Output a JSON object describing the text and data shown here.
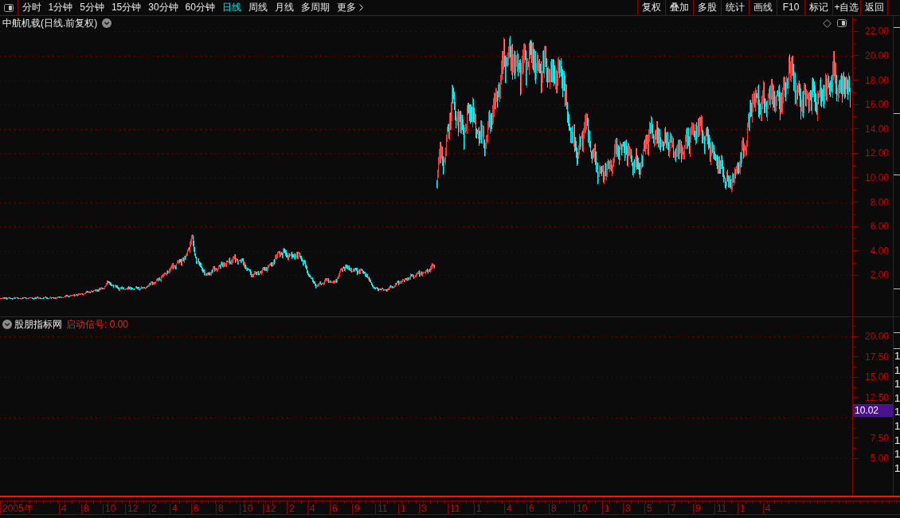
{
  "toolbar": {
    "period_tabs": [
      {
        "label": "分时",
        "kind": "period",
        "selected": false
      },
      {
        "label": "1分钟",
        "kind": "period",
        "selected": false
      },
      {
        "label": "5分钟",
        "kind": "period",
        "selected": false
      },
      {
        "label": "15分钟",
        "kind": "period",
        "selected": false
      },
      {
        "label": "30分钟",
        "kind": "period",
        "selected": false
      },
      {
        "label": "60分钟",
        "kind": "period",
        "selected": false
      },
      {
        "label": "日线",
        "kind": "period",
        "selected": true
      },
      {
        "label": "周线",
        "kind": "period",
        "selected": false
      },
      {
        "label": "月线",
        "kind": "period",
        "selected": false
      },
      {
        "label": "多周期",
        "kind": "period",
        "selected": false
      },
      {
        "label": "更多",
        "kind": "menu",
        "selected": false
      }
    ],
    "buttons": [
      "复权",
      "叠加",
      "多股",
      "统计",
      "画线",
      "F10",
      "标记",
      "+自选",
      "返回"
    ]
  },
  "main_chart": {
    "title": "中航机载(日线.前复权)",
    "price_axis": [
      "22.00",
      "20.00",
      "18.00",
      "16.00",
      "14.00",
      "12.00",
      "10.00",
      "8.00",
      "6.00",
      "4.00",
      "2.00"
    ]
  },
  "indicator": {
    "name": "股朋指标网",
    "readout": "启动信号: 0.00",
    "axis": [
      {
        "kind": "label",
        "text": "20.00"
      },
      {
        "kind": "label",
        "text": "17.50"
      },
      {
        "kind": "label",
        "text": "15.00"
      },
      {
        "kind": "label",
        "text": "12.50"
      },
      {
        "kind": "badge",
        "text": "10.02"
      },
      {
        "kind": "label",
        "text": "7.50"
      },
      {
        "kind": "label",
        "text": "5.00"
      }
    ],
    "side_column": [
      "1",
      "1",
      "1",
      "1",
      "1",
      "1",
      "1",
      "1",
      "1"
    ]
  },
  "date_axis": [
    "2005年",
    "4",
    "8",
    "10",
    "12",
    "2",
    "4",
    "6",
    "8",
    "10",
    "12",
    "2",
    "4",
    "6",
    "9",
    "11",
    "1",
    "3",
    "11",
    "1",
    "4",
    "6",
    "8",
    "10",
    "1",
    "3",
    "5",
    "7",
    "9",
    "11",
    "1",
    "4"
  ]
}
